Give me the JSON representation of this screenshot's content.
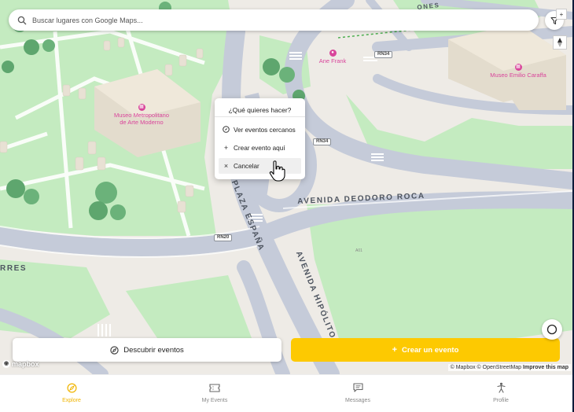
{
  "search": {
    "placeholder": "Buscar lugares con Google Maps..."
  },
  "map": {
    "street_labels": {
      "avenida_deodoro_roca": "AVENIDA DEODORO ROCA",
      "plaza_espana": "PLAZA ESPAÑA",
      "avenida_hipolito": "AVENIDA HIPÓLITO",
      "rres": "RRES",
      "top_right": "ONES"
    },
    "pois": {
      "museo_metropolitano": "Museo Metropolitano\nde Arte Moderno",
      "ane_frank": "Ane Frank",
      "museo_caraffa": "Museo Emilio Caraffa"
    },
    "shields": {
      "rn34_top": "RN34",
      "rn34_mid": "RN34",
      "rn20": "RN20",
      "a01": "A01"
    },
    "colors": {
      "park": "#c4ebc0",
      "road": "#c5cbd9",
      "land": "#eeebe6",
      "building": "#e8e1d4",
      "poi": "#d9459b"
    }
  },
  "context_menu": {
    "title": "¿Qué quieres hacer?",
    "items": [
      {
        "label": "Ver eventos cercanos",
        "icon": "compass-icon"
      },
      {
        "label": "Crear evento aquí",
        "icon": "plus-icon"
      },
      {
        "label": "Cancelar",
        "icon": "close-icon"
      }
    ]
  },
  "buttons": {
    "discover": "Descubrir eventos",
    "create": "Crear un evento",
    "create_plus": "+"
  },
  "attribution": {
    "mapbox_logo": "mapbox",
    "text": "© Mapbox © OpenStreetMap",
    "improve": "Improve this map"
  },
  "nav": {
    "items": [
      {
        "label": "Explore",
        "icon": "compass-icon",
        "active": true
      },
      {
        "label": "My Events",
        "icon": "ticket-icon",
        "active": false
      },
      {
        "label": "Messages",
        "icon": "message-icon",
        "active": false
      },
      {
        "label": "Profile",
        "icon": "person-icon",
        "active": false
      }
    ],
    "accent": "#f0b400"
  }
}
